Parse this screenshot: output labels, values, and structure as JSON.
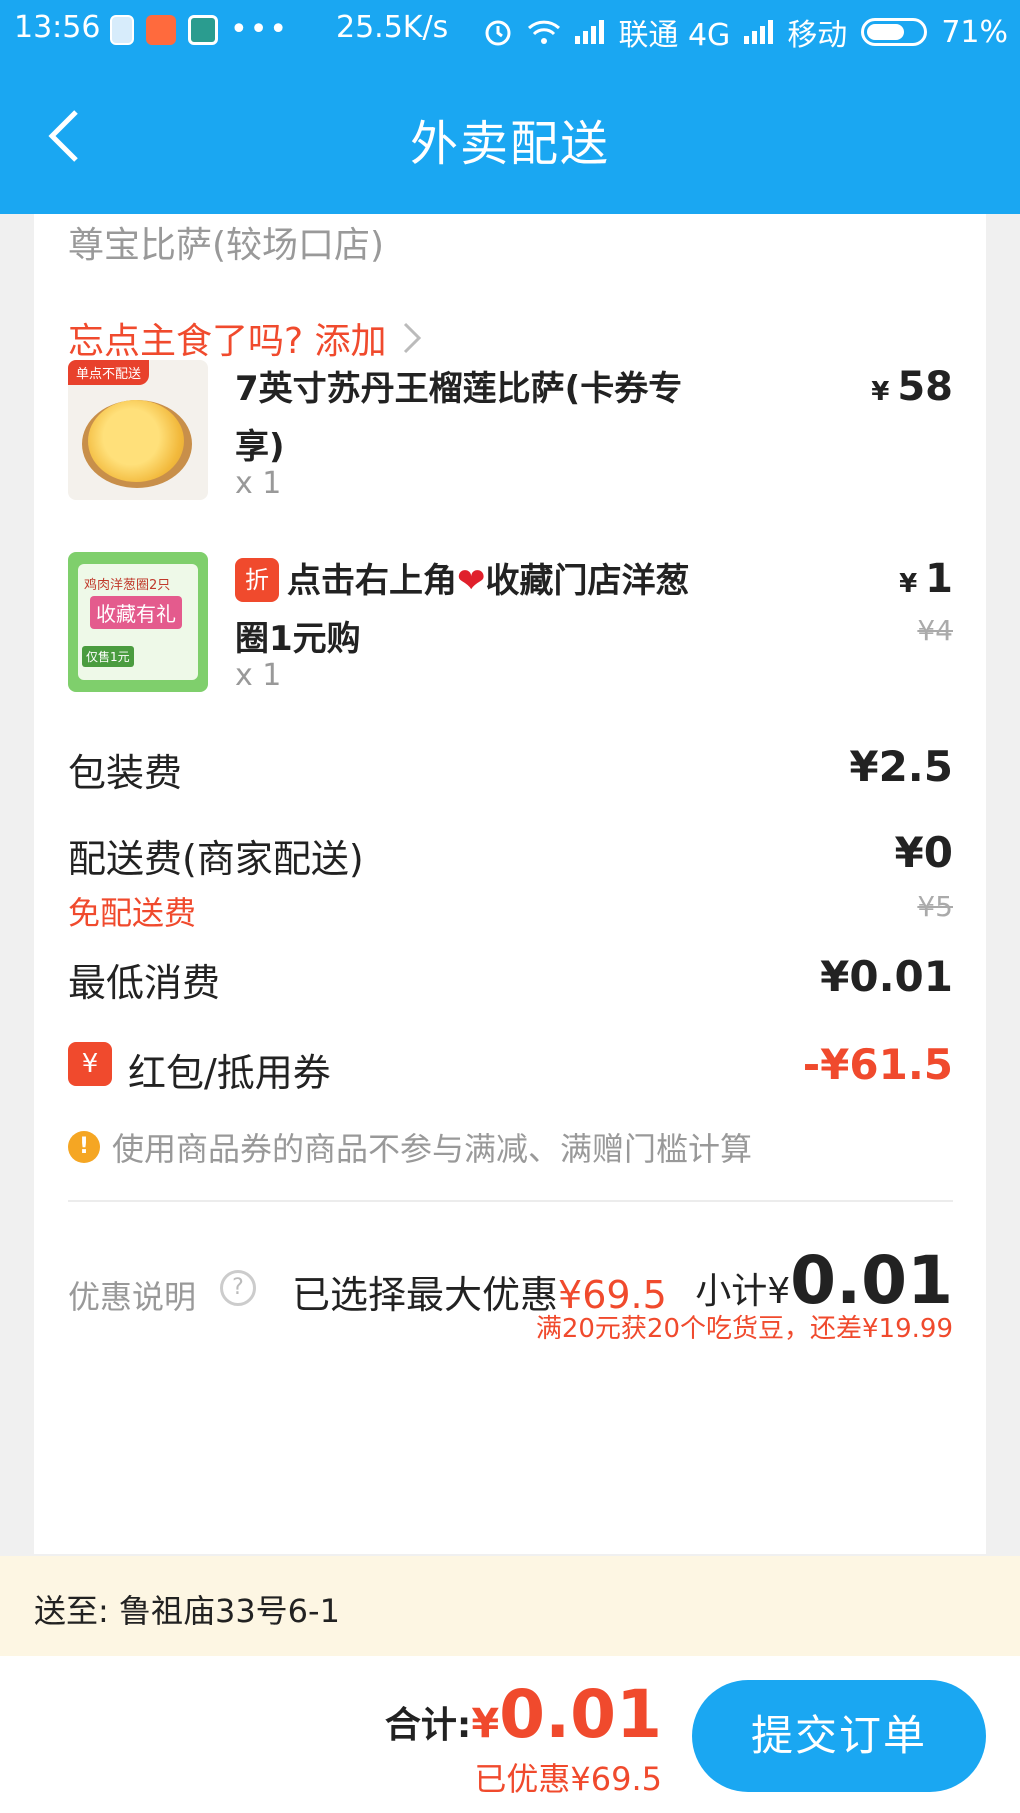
{
  "status_bar": {
    "time": "13:56",
    "net_speed": "25.5K/s",
    "carrier1": "联通 4G",
    "carrier2": "移动",
    "battery": "71%",
    "battery_level": 0.71
  },
  "header": {
    "title": "外卖配送"
  },
  "shop": {
    "name": "尊宝比萨(较场口店)"
  },
  "addon_prompt": "忘点主食了吗? 添加",
  "items": [
    {
      "badge": "单点不配送",
      "name": "7英寸苏丹王榴莲比萨(卡券专享)",
      "qty": "x 1",
      "price_symbol": "¥",
      "price": "58"
    },
    {
      "thumb_line1": "鸡肉洋葱圈2只",
      "thumb_line2": "收藏有礼",
      "thumb_line3": "仅售1元",
      "discount_badge": "折",
      "name_part1": "点击右上角",
      "name_heart": "❤",
      "name_part2": "收藏门店洋葱圈1元购",
      "qty": "x 1",
      "price_symbol": "¥",
      "price": "1",
      "original_price": "¥4"
    }
  ],
  "fees": {
    "packing_label": "包装费",
    "packing_value": "¥2.5",
    "delivery_label": "配送费(商家配送)",
    "delivery_value": "¥0",
    "free_delivery": "免配送费",
    "delivery_original": "¥5",
    "min_label": "最低消费",
    "min_value": "¥0.01"
  },
  "coupon": {
    "icon_text": "¥",
    "label": "红包/抵用券",
    "amount": "-¥61.5"
  },
  "notice": {
    "icon_text": "!",
    "text": "使用商品券的商品不参与满减、满赠门槛计算"
  },
  "summary": {
    "discount_label": "优惠说明",
    "help_icon_text": "?",
    "selected_prefix": "已选择最大优惠",
    "selected_amount": "¥69.5",
    "subtotal_label": "小计¥",
    "subtotal_value": "0.01",
    "bean_tip": "满20元获20个吃货豆，还差¥19.99"
  },
  "address": {
    "text": "送至: 鲁祖庙33号6-1"
  },
  "bottom": {
    "total_label": "合计:",
    "total_symbol": "¥",
    "total_value": "0.01",
    "saved": "已优惠¥69.5",
    "submit_label": "提交订单"
  },
  "colors": {
    "brand_blue": "#1aa7f2",
    "accent_red": "#f04a2d",
    "address_bg": "#fdf6e3"
  }
}
